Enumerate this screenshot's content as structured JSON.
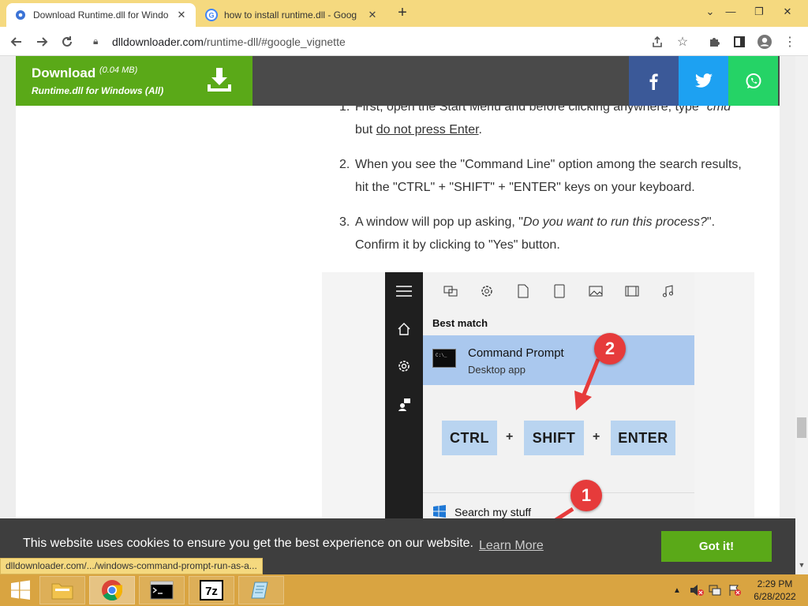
{
  "browser": {
    "tabs": [
      {
        "title": "Download Runtime.dll for Windo",
        "active": true
      },
      {
        "title": "how to install runtime.dll - Goog",
        "active": false
      }
    ],
    "address": {
      "host": "dlldownloader.com",
      "path": "/runtime-dll/#google_vignette"
    },
    "new_tab_label": "+"
  },
  "download_bar": {
    "title": "Download",
    "size": "(0.04 MB)",
    "subtitle": "Runtime.dll for Windows (All)"
  },
  "steps": {
    "step1": {
      "num": "1.",
      "pre": "First, open the Start Menu and before clicking anywhere, type \"",
      "cmd": "cmd",
      "post": "\" but ",
      "underline": "do not press Enter",
      "end": "."
    },
    "step2": {
      "num": "2.",
      "text": "When you see the \"Command Line\" option among the search results, hit the \"CTRL\" + \"SHIFT\" + \"ENTER\" keys on your keyboard."
    },
    "step3": {
      "num": "3.",
      "pre": "A window will pop up asking, \"",
      "italic": "Do you want to run this process?",
      "post": "\". Confirm it by clicking to \"Yes\" button."
    }
  },
  "figure": {
    "best_match": "Best match",
    "result_name": "Command Prompt",
    "result_sub": "Desktop app",
    "keys": [
      "CTRL",
      "SHIFT",
      "ENTER"
    ],
    "plus": "+",
    "search_label": "Search my stuff",
    "badges": [
      "1",
      "2"
    ]
  },
  "cookie": {
    "message": "This website uses cookies to ensure you get the best experience on our website.",
    "learn_more": "Learn More",
    "button": "Got it!"
  },
  "status_url": "dlldownloader.com/.../windows-command-prompt-run-as-a...",
  "taskbar": {
    "time": "2:29 PM",
    "date": "6/28/2022"
  },
  "colors": {
    "download_green": "#5aa918",
    "facebook": "#3b5998",
    "twitter": "#1da1f2",
    "whatsapp": "#25d366",
    "tabstrip": "#f5d97f",
    "taskbar": "#d9a441"
  }
}
